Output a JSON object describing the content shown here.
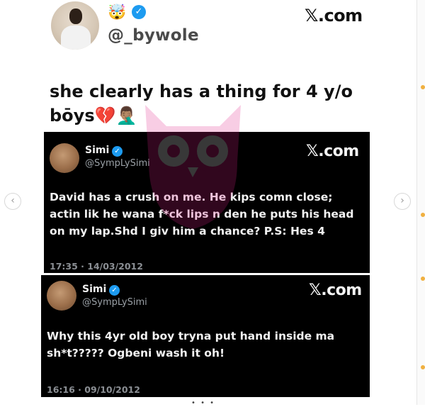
{
  "header": {
    "emoji": "🤯",
    "handle": "@_bywole",
    "site": "𝕏.com"
  },
  "tweet": {
    "text": "she clearly has a thing for 4 y/o bōys💔🤦🏽‍♂️"
  },
  "quoted": [
    {
      "name": "Simi",
      "username": "@SympLySimi",
      "site": "𝕏.com",
      "text": "David has a crush on me. He kips comn close; actin lik he wana f*ck lips n den he puts his head on my lap.Shd I giv him a chance? P.S: Hes 4",
      "timestamp": "17:35 · 14/03/2012"
    },
    {
      "name": "Simi",
      "username": "@SympLySimi",
      "site": "𝕏.com",
      "text": "Why this 4yr old boy tryna put hand inside ma sh*t????? Ogbeni wash it oh!",
      "timestamp": "16:16 · 09/10/2012"
    }
  ],
  "nav": {
    "prev": "‹",
    "next": "›"
  },
  "colors": {
    "verified": "#1d9bf0",
    "card_bg": "#000000",
    "watermark": "#e0208a"
  }
}
